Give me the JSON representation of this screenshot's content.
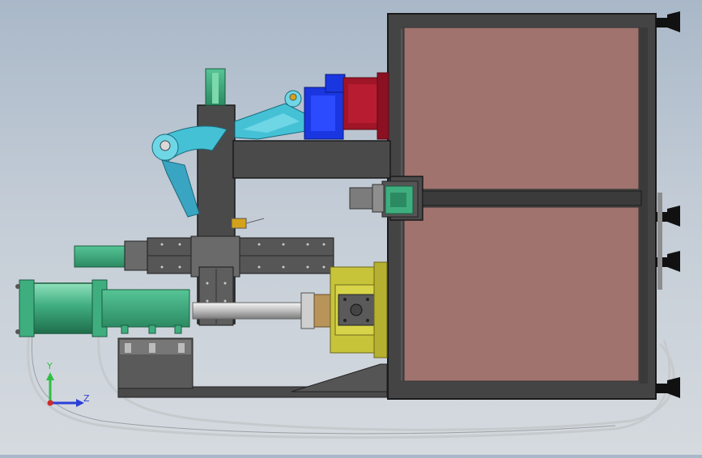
{
  "view": {
    "background_top": "#a9b8c8",
    "background_bottom": "#d5dadf"
  },
  "colors": {
    "frame": "#3e3e3e",
    "panel": "#a0736e",
    "cylinder": "#3fae7f",
    "arm": "#45c1d6",
    "arm_link": "#3aa5c2",
    "motor_blue": "#1a36e0",
    "motor_red": "#a01528",
    "yellow_block": "#c8c43a",
    "rail": "#5a5a5a",
    "rod": "#d9d9d9",
    "hose": "#cfd3d6",
    "axis_y": "#2fbf45",
    "axis_z": "#2b3fd8",
    "axis_x": "#d02b2b"
  },
  "axis_triad": {
    "y_label": "Y",
    "z_label": "Z"
  }
}
